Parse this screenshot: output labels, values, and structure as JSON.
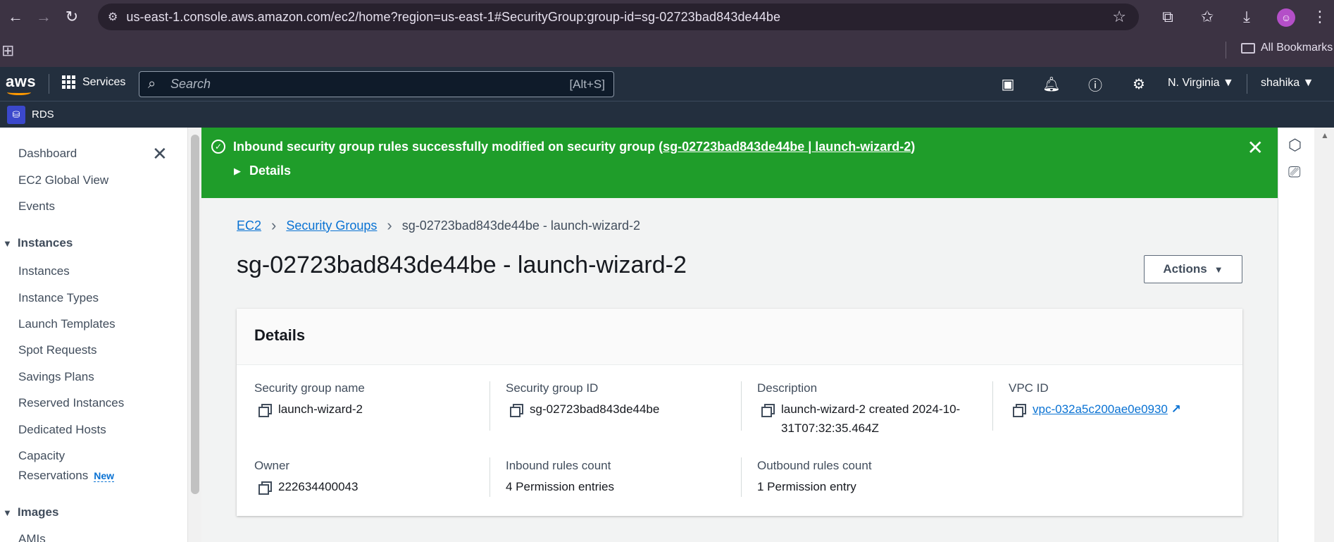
{
  "browser": {
    "url": "us-east-1.console.aws.amazon.com/ec2/home?region=us-east-1#SecurityGroup:group-id=sg-02723bad843de44be",
    "bookmarks_label": "All Bookmarks"
  },
  "aws_nav": {
    "logo": "aws",
    "services_label": "Services",
    "search_placeholder": "Search",
    "search_shortcut": "[Alt+S]",
    "region": "N. Virginia",
    "user": "shahika",
    "favorite_service": "RDS"
  },
  "sidebar": {
    "items_top": [
      "Dashboard",
      "EC2 Global View",
      "Events"
    ],
    "instances_section": "Instances",
    "instances_items": [
      "Instances",
      "Instance Types",
      "Launch Templates",
      "Spot Requests",
      "Savings Plans",
      "Reserved Instances",
      "Dedicated Hosts"
    ],
    "capacity_line1": "Capacity",
    "capacity_line2": "Reservations",
    "new_badge": "New",
    "images_section": "Images",
    "amis": "AMIs"
  },
  "flash": {
    "message_prefix": "Inbound security group rules successfully modified on security group (",
    "message_link": "sg-02723bad843de44be | launch-wizard-2",
    "message_suffix": ")",
    "details_label": "Details",
    "color": "#1f9d2a"
  },
  "breadcrumb": {
    "ec2": "EC2",
    "security_groups": "Security Groups",
    "current": "sg-02723bad843de44be - launch-wizard-2"
  },
  "page": {
    "title": "sg-02723bad843de44be - launch-wizard-2",
    "actions_label": "Actions"
  },
  "details": {
    "heading": "Details",
    "sg_name_label": "Security group name",
    "sg_name_value": "launch-wizard-2",
    "sg_id_label": "Security group ID",
    "sg_id_value": "sg-02723bad843de44be",
    "description_label": "Description",
    "description_value": "launch-wizard-2 created 2024-10-31T07:32:35.464Z",
    "vpc_label": "VPC ID",
    "vpc_value": "vpc-032a5c200ae0e0930",
    "owner_label": "Owner",
    "owner_value": "222634400043",
    "inbound_label": "Inbound rules count",
    "inbound_value": "4 Permission entries",
    "outbound_label": "Outbound rules count",
    "outbound_value": "1 Permission entry"
  }
}
